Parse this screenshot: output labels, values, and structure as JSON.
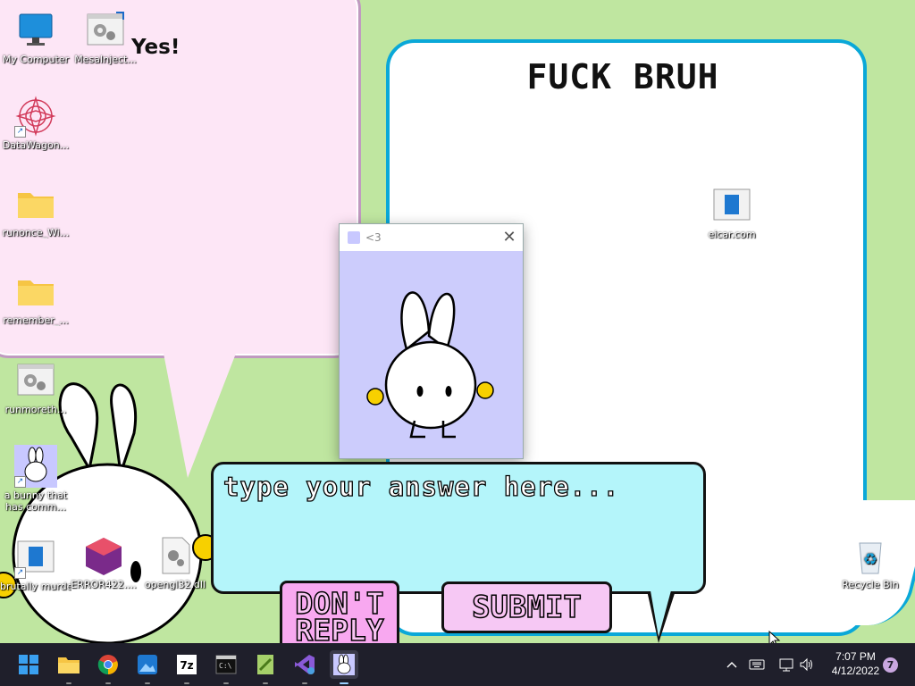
{
  "desktop": {
    "caption_yes": "Yes!",
    "caption_heading": "FUCK BRUH",
    "icons": [
      {
        "label": "My Computer"
      },
      {
        "label": "MesaInject..."
      },
      {
        "label": "DataWagon..."
      },
      {
        "label": "runonce_Wi..."
      },
      {
        "label": "remember_..."
      },
      {
        "label": "runmoreth..."
      },
      {
        "label": "a bunny that has comm..."
      },
      {
        "label": "brutally murder..."
      },
      {
        "label": "ERROR422...."
      },
      {
        "label": "opengl32.dll"
      },
      {
        "label": "eicar.com"
      },
      {
        "label": "Recycle Bin"
      }
    ]
  },
  "dialog": {
    "title": "<3",
    "close_symbol": "✕"
  },
  "answer": {
    "placeholder": "type your answer here..."
  },
  "buttons": {
    "dont_reply": "DON'T REPLY",
    "submit": "SUBMIT"
  },
  "taskbar": {
    "apps": [
      "start-icon",
      "file-explorer-icon",
      "chrome-icon",
      "photos-icon",
      "7zip-icon",
      "terminal-icon",
      "notepad-plus-icon",
      "visual-studio-icon",
      "bunny-app-icon"
    ],
    "time": "7:07 PM",
    "date": "4/12/2022",
    "notification_count": "7"
  },
  "colors": {
    "desktop_bg": "#bfe6a0",
    "left_bubble": "#fde6f6",
    "right_bubble_border": "#0aa8d8",
    "answer_bg": "#b4f5fa",
    "button_pink": "#f8a8f0",
    "dialog_bg": "#ccccfc"
  }
}
